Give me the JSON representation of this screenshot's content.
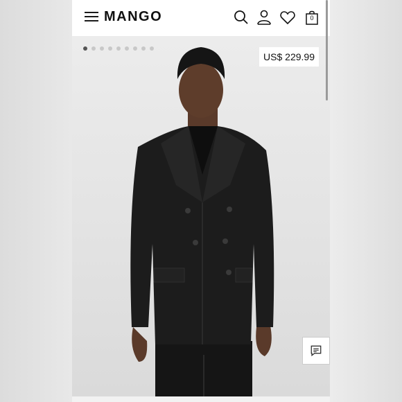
{
  "header": {
    "logo": "MANGO",
    "bag_count": "0",
    "icons": [
      "menu-icon",
      "search-icon",
      "account-icon",
      "heart-icon",
      "bag-icon"
    ]
  },
  "gallery": {
    "total_images": 9,
    "active_index": 0
  },
  "product": {
    "price": "US$ 229.99"
  },
  "colors": {
    "header_bg": "#ffffff",
    "photo_bg": "#e4e4e4",
    "jacket": "#1c1c1c"
  }
}
